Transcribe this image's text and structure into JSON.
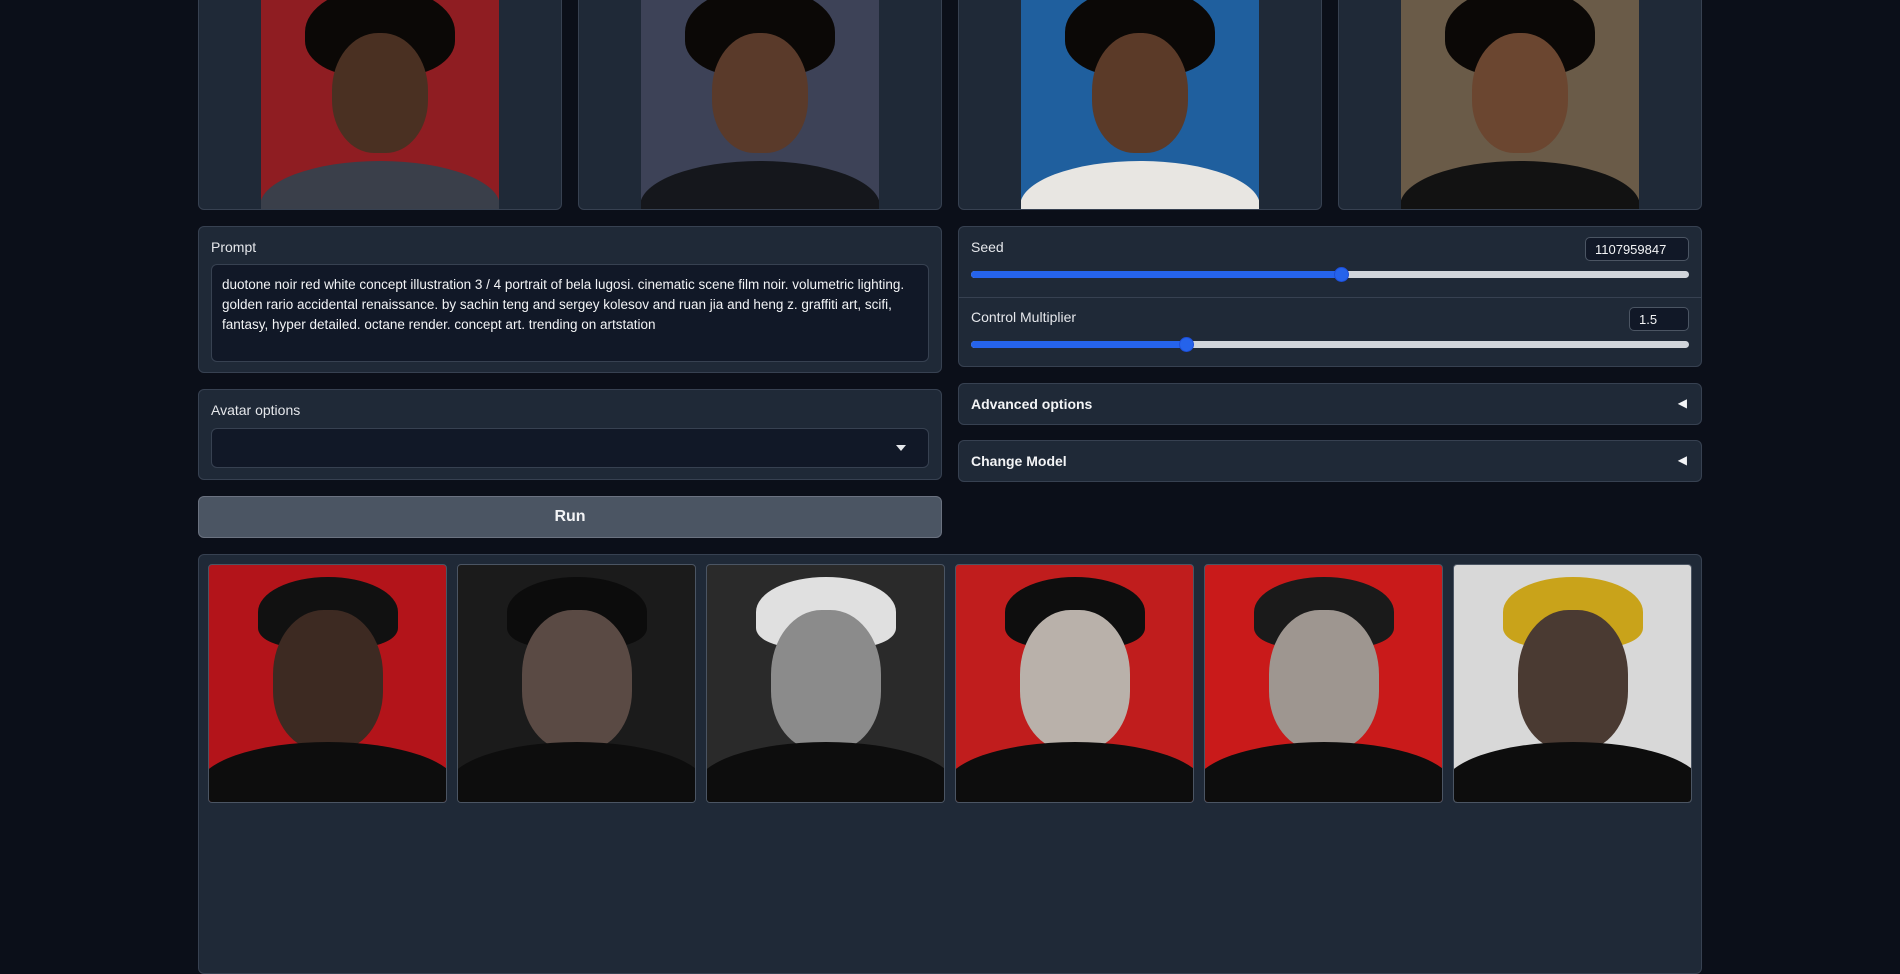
{
  "input_images": [
    {
      "name": "input-photo-1",
      "bg": "#8f1d22",
      "skin": "#4a3022",
      "shirt": "#3a3f4a"
    },
    {
      "name": "input-photo-2",
      "bg": "#3d4257",
      "skin": "#5a3a2a",
      "shirt": "#15171c"
    },
    {
      "name": "input-photo-3",
      "bg": "#1f5f9e",
      "skin": "#5b3a28",
      "shirt": "#e8e6e2"
    },
    {
      "name": "input-photo-4",
      "bg": "#6a5b48",
      "skin": "#6b4630",
      "shirt": "#121212"
    }
  ],
  "prompt": {
    "label": "Prompt",
    "value": "duotone noir red white concept illustration 3 / 4 portrait of bela lugosi. cinematic scene film noir. volumetric lighting. golden rario accidental renaissance. by sachin teng and sergey kolesov and ruan jia and heng z. graffiti art, scifi, fantasy, hyper detailed. octane render. concept art. trending on artstation"
  },
  "seed": {
    "label": "Seed",
    "value": "1107959847",
    "fraction": 0.516
  },
  "control_multiplier": {
    "label": "Control Multiplier",
    "value": "1.5",
    "fraction": 0.3
  },
  "avatar_options": {
    "label": "Avatar options",
    "selected": ""
  },
  "advanced_options": {
    "label": "Advanced options"
  },
  "change_model": {
    "label": "Change Model"
  },
  "run_button": {
    "label": "Run"
  },
  "icons": {
    "dropdown": "chevron-down-icon",
    "accordion": "triangle-left-icon"
  },
  "output_images": [
    {
      "name": "output-image-1",
      "bg": "#b3141a",
      "skin": "#3d2a22",
      "hair": "#111111"
    },
    {
      "name": "output-image-2",
      "bg": "#1b1b1b",
      "skin": "#5a4a44",
      "hair": "#0c0c0c"
    },
    {
      "name": "output-image-3",
      "bg": "#2a2a2a",
      "skin": "#8b8b8b",
      "hair": "#e0e0e0"
    },
    {
      "name": "output-image-4",
      "bg": "#c01d1d",
      "skin": "#b9b1aa",
      "hair": "#0e0e0e"
    },
    {
      "name": "output-image-5",
      "bg": "#c91a1a",
      "skin": "#9e9690",
      "hair": "#1a1a1a"
    },
    {
      "name": "output-image-6",
      "bg": "#d8d8d8",
      "skin": "#4a3a32",
      "hair": "#c9a31a"
    }
  ]
}
